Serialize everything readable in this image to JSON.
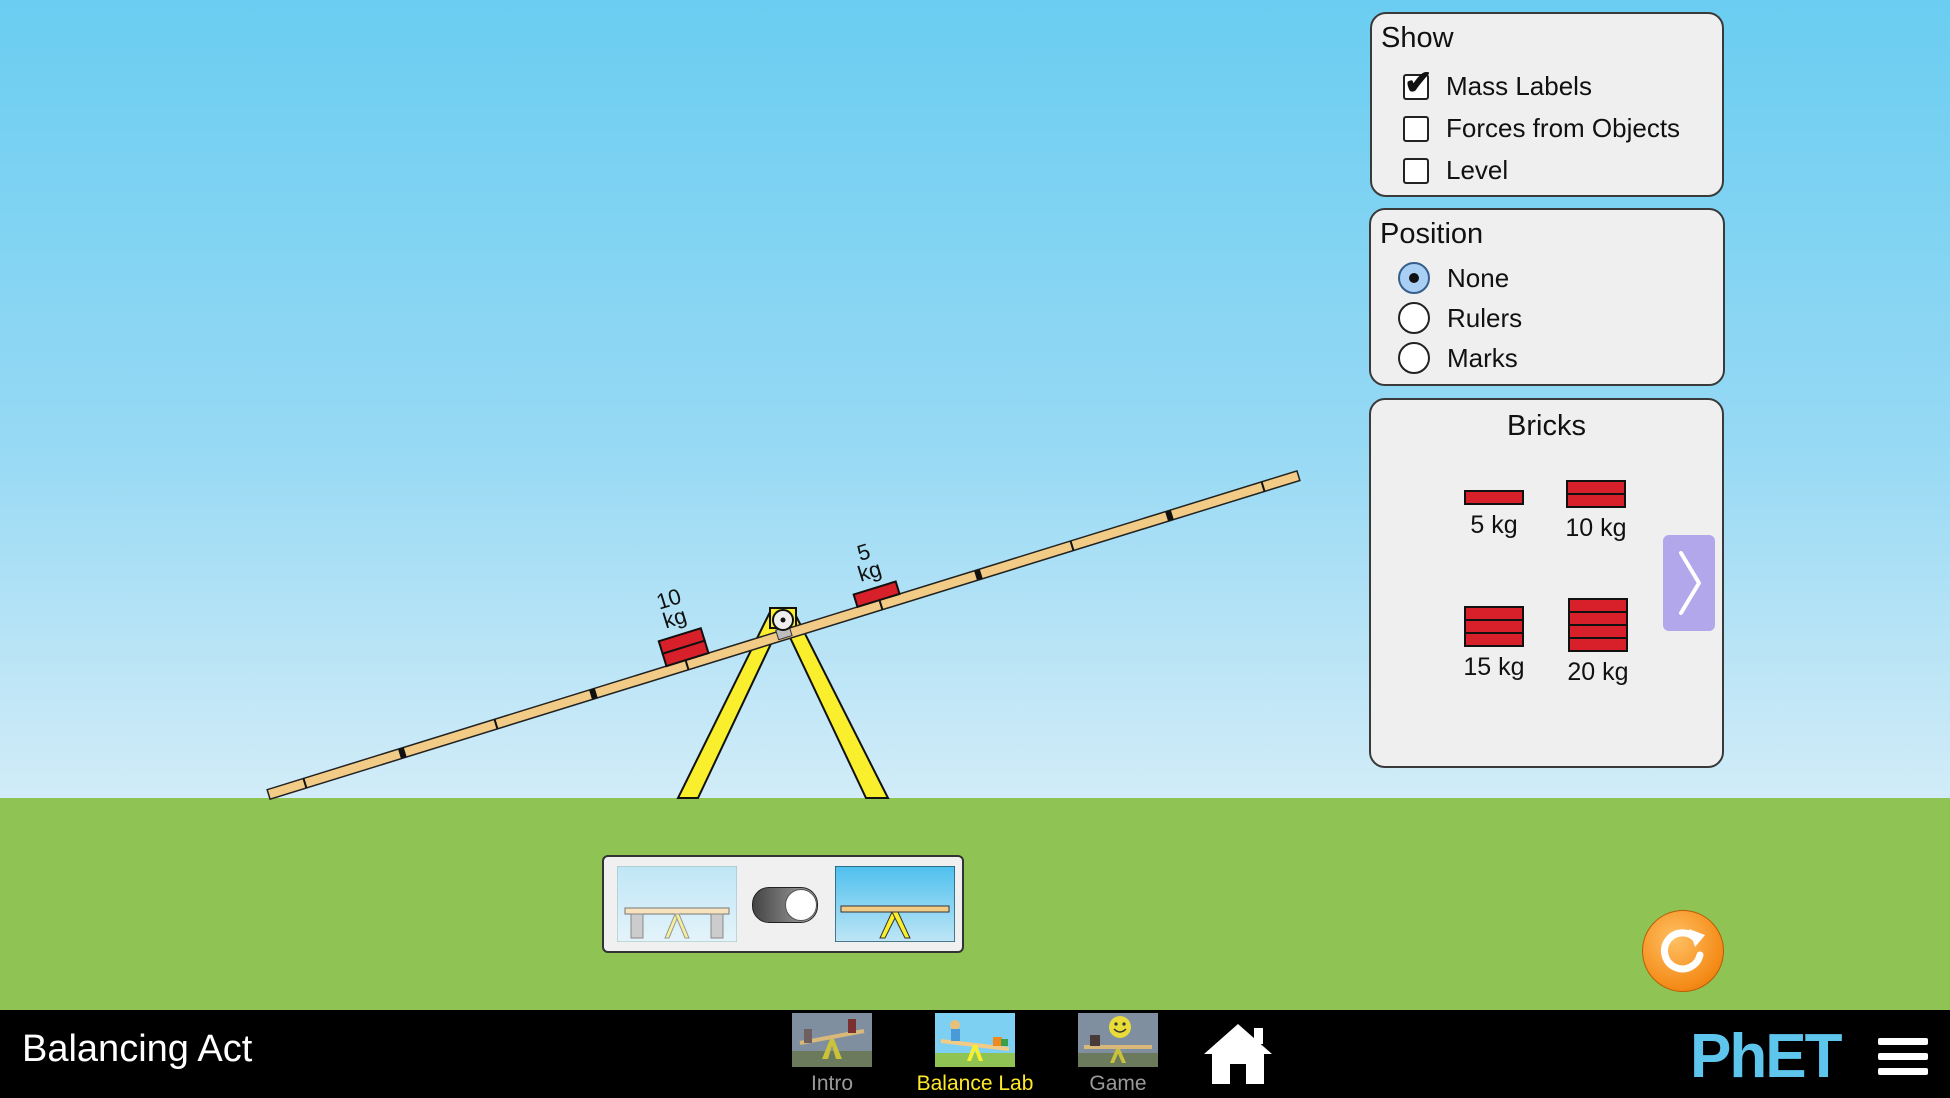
{
  "app": {
    "title": "Balancing Act"
  },
  "show_panel": {
    "title": "Show",
    "options": [
      {
        "label": "Mass Labels",
        "checked": true
      },
      {
        "label": "Forces from Objects",
        "checked": false
      },
      {
        "label": "Level",
        "checked": false
      }
    ]
  },
  "position_panel": {
    "title": "Position",
    "options": [
      {
        "label": "None",
        "selected": true
      },
      {
        "label": "Rulers",
        "selected": false
      },
      {
        "label": "Marks",
        "selected": false
      }
    ]
  },
  "bricks_panel": {
    "title": "Bricks",
    "items": [
      {
        "label": "5 kg",
        "layers": 1
      },
      {
        "label": "10 kg",
        "layers": 2
      },
      {
        "label": "15 kg",
        "layers": 3
      },
      {
        "label": "20 kg",
        "layers": 4
      }
    ],
    "next_icon": "chevron-right-icon"
  },
  "plank": {
    "masses": [
      {
        "mass_line1": "10",
        "mass_line2": "kg",
        "layers": 2,
        "side": "left"
      },
      {
        "mass_line1": "5",
        "mass_line2": "kg",
        "layers": 1,
        "side": "right"
      }
    ]
  },
  "support_toggle": {
    "state": "supports-removed",
    "left_icon": "supports-image",
    "right_icon": "no-supports-image"
  },
  "reset": {
    "icon": "reset-icon"
  },
  "nav": {
    "tabs": [
      {
        "label": "Intro",
        "active": false
      },
      {
        "label": "Balance Lab",
        "active": true
      },
      {
        "label": "Game",
        "active": false
      }
    ],
    "home_icon": "home-icon",
    "logo": "PhET",
    "menu_icon": "hamburger-menu-icon"
  },
  "colors": {
    "brick": "#d8202a",
    "plank": "#f2cc86",
    "fulcrum": "#f9ef2d",
    "ground": "#8fc454",
    "sky_top": "#6acdf1",
    "reset": "#f48a16",
    "nav_active": "#ffea2a",
    "next_button": "#b1a7ea"
  }
}
